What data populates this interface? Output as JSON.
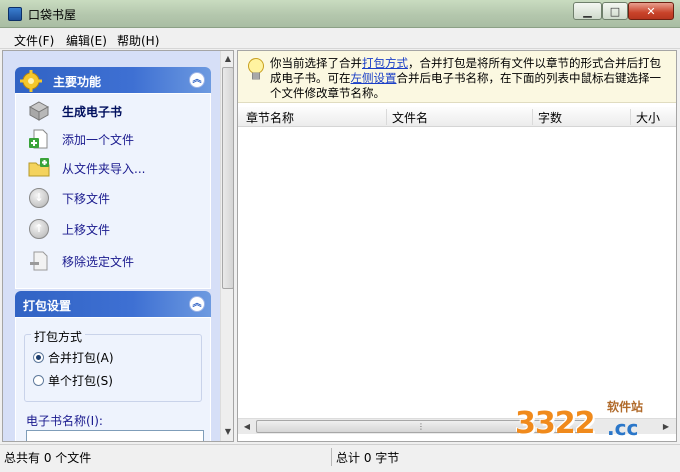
{
  "window": {
    "title": "口袋书屋",
    "min_label": "▁",
    "max_label": "□",
    "close_label": "✕"
  },
  "menu": {
    "file": "文件(F)",
    "edit": "编辑(E)",
    "help": "帮助(H)"
  },
  "sidebar": {
    "main_group": {
      "title": "主要功能",
      "items": [
        {
          "label": "生成电子书",
          "icon": "book-box-icon"
        },
        {
          "label": "添加一个文件",
          "icon": "add-file-icon"
        },
        {
          "label": "从文件夹导入...",
          "icon": "folder-import-icon"
        },
        {
          "label": "下移文件",
          "icon": "arrow-down-icon"
        },
        {
          "label": "上移文件",
          "icon": "arrow-up-icon"
        },
        {
          "label": "移除选定文件",
          "icon": "remove-file-icon"
        }
      ]
    },
    "pack_group": {
      "title": "打包设置",
      "mode_label": "打包方式",
      "option_merge": "合并打包(A)",
      "option_single": "单个打包(S)",
      "selected": "merge",
      "ebook_name_label": "电子书名称(I):",
      "ebook_name_value": ""
    }
  },
  "info": {
    "p1": "你当前选择了合并",
    "link1": "打包方式",
    "p2": "，合并打包是将所有文件以章节的形式合并后打包成电子书。可在",
    "link2": "左侧设置",
    "p3": "合并后电子书名称，在下面的列表中鼠标右键选择一个文件修改章节名称。"
  },
  "table": {
    "columns": [
      "章节名称",
      "文件名",
      "字数",
      "大小"
    ],
    "rows": []
  },
  "status": {
    "files": "总共有 0 个文件",
    "bytes": "总计 0 字节"
  },
  "watermark": {
    "top": "软件站",
    "main": "3322",
    "suffix": ".cc"
  }
}
